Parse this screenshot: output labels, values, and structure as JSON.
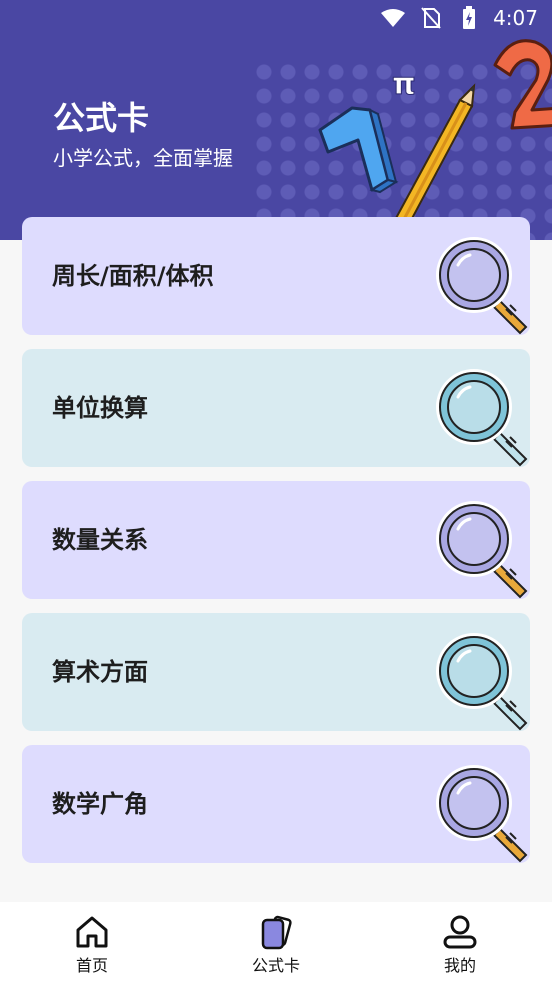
{
  "status_bar": {
    "time": "4:07",
    "icons": [
      "wifi-icon",
      "no-sim-icon",
      "battery-icon"
    ]
  },
  "header": {
    "title": "公式卡",
    "subtitle": "小学公式，全面掌握",
    "decor_symbol": "π",
    "decor_digit_one": "1",
    "decor_digit_two": "2"
  },
  "cards": [
    {
      "label": "周长/面积/体积",
      "theme": "purple"
    },
    {
      "label": "单位换算",
      "theme": "blue"
    },
    {
      "label": "数量关系",
      "theme": "purple"
    },
    {
      "label": "算术方面",
      "theme": "blue"
    },
    {
      "label": "数学广角",
      "theme": "purple"
    }
  ],
  "tabbar": {
    "tabs": [
      {
        "label": "首页",
        "icon": "home-icon"
      },
      {
        "label": "公式卡",
        "icon": "cards-icon",
        "active": true
      },
      {
        "label": "我的",
        "icon": "profile-icon"
      }
    ]
  },
  "colors": {
    "header_bg": "#4a47a3",
    "card_purple": "#dedcfe",
    "card_blue": "#d9ebf1",
    "active_tab": "#8a88e0"
  }
}
